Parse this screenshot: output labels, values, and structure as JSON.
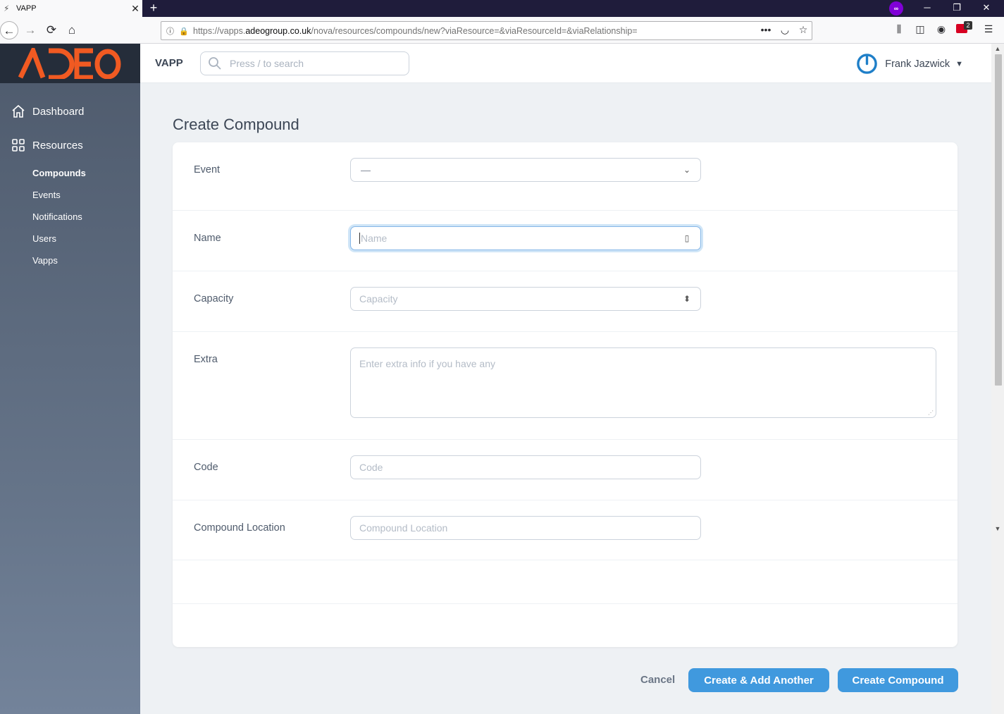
{
  "browser": {
    "tab_title": "VAPP",
    "tab_close": "✕",
    "new_tab": "+",
    "url_prefix": "https://vapps.",
    "url_domain": "adeogroup.co.uk",
    "url_path": "/nova/resources/compounds/new?viaResource=&viaResourceId=&viaRelationship=",
    "badge_count": "2"
  },
  "sidebar": {
    "logo_text": "ADEO",
    "items": [
      {
        "label": "Dashboard",
        "icon": "home-icon"
      },
      {
        "label": "Resources",
        "icon": "grid-icon"
      }
    ],
    "sub_items": [
      {
        "label": "Compounds",
        "active": true
      },
      {
        "label": "Events",
        "active": false
      },
      {
        "label": "Notifications",
        "active": false
      },
      {
        "label": "Users",
        "active": false
      },
      {
        "label": "Vapps",
        "active": false
      }
    ]
  },
  "header": {
    "brand": "VAPP",
    "search_placeholder": "Press / to search",
    "user_name": "Frank Jazwick"
  },
  "page": {
    "title": "Create Compound",
    "fields": {
      "event": {
        "label": "Event",
        "value": "—"
      },
      "name": {
        "label": "Name",
        "placeholder": "Name"
      },
      "capacity": {
        "label": "Capacity",
        "placeholder": "Capacity"
      },
      "extra": {
        "label": "Extra",
        "placeholder": "Enter extra info if you have any"
      },
      "code": {
        "label": "Code",
        "placeholder": "Code"
      },
      "location": {
        "label": "Compound Location",
        "placeholder": "Compound Location"
      }
    },
    "actions": {
      "cancel": "Cancel",
      "create_add_another": "Create & Add Another",
      "create": "Create Compound"
    }
  },
  "colors": {
    "accent": "#4099de",
    "logo_orange": "#f15a22",
    "sidebar": "#4e5a6c"
  }
}
